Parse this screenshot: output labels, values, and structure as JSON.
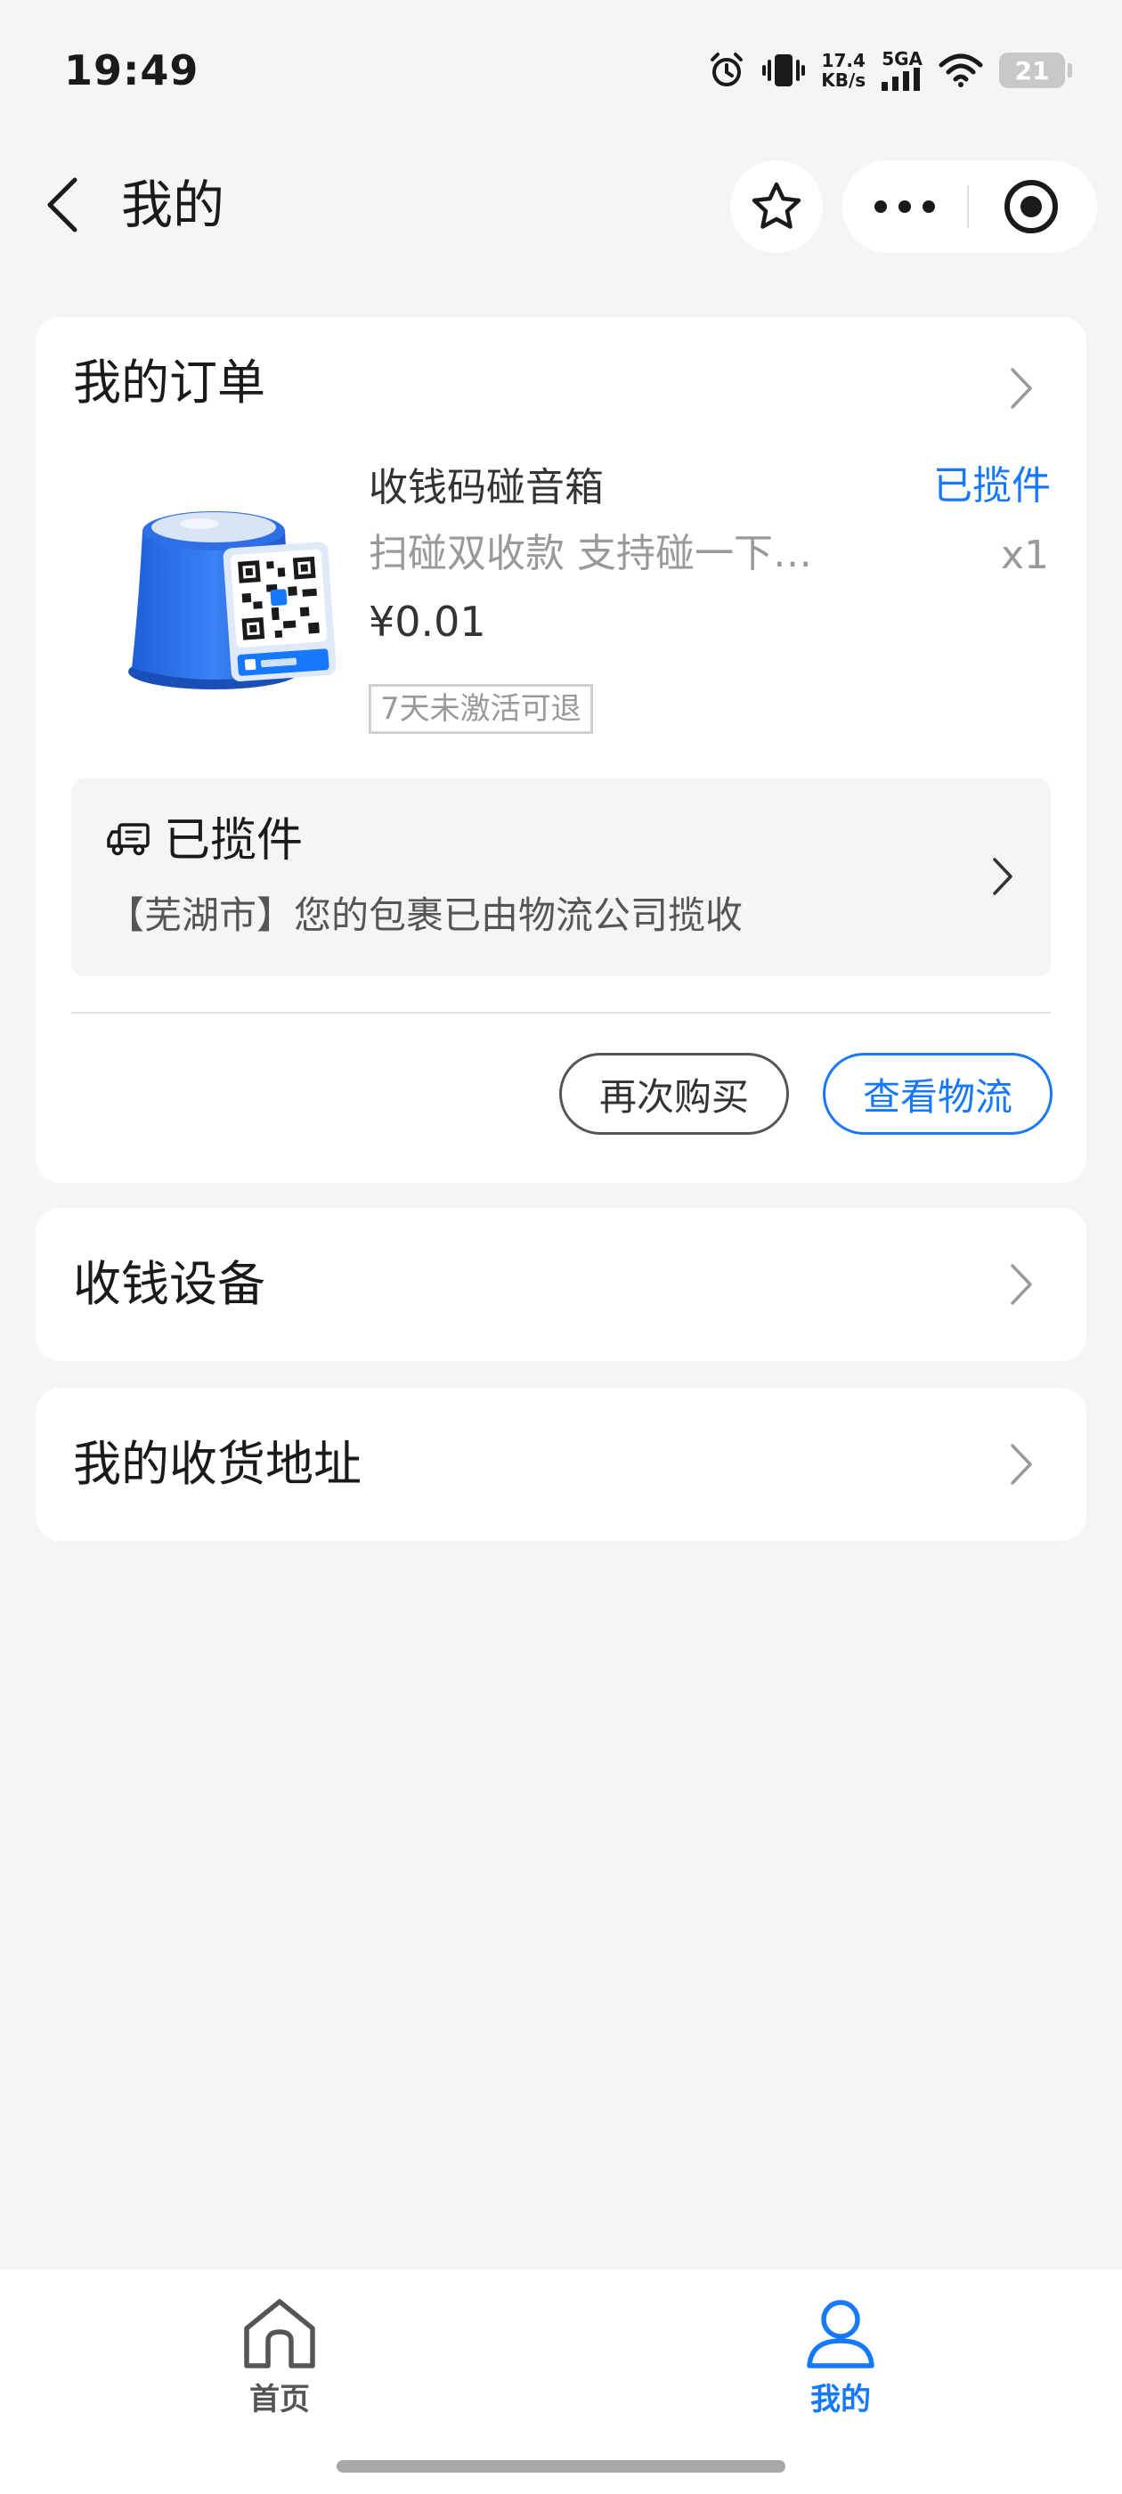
{
  "status_bar": {
    "time": "19:49",
    "net_speed_value": "17.4",
    "net_speed_unit": "KB/s",
    "network": "5GA",
    "battery": "21"
  },
  "nav": {
    "title": "我的"
  },
  "order": {
    "header": "我的订单",
    "product_name": "收钱码碰音箱",
    "status": "已揽件",
    "description": "扫碰双收款  支持碰一下…",
    "quantity": "x1",
    "price": "¥0.01",
    "return_tag": "7天未激活可退",
    "logistics_title": "已揽件",
    "logistics_detail": "【芜湖市】您的包裹已由物流公司揽收",
    "rebuy_label": "再次购买",
    "track_label": "查看物流"
  },
  "menu": {
    "devices": "收钱设备",
    "address": "我的收货地址"
  },
  "tabs": {
    "home": "首页",
    "mine": "我的"
  },
  "colors": {
    "accent": "#1677ff",
    "background": "#f5f5f5"
  }
}
